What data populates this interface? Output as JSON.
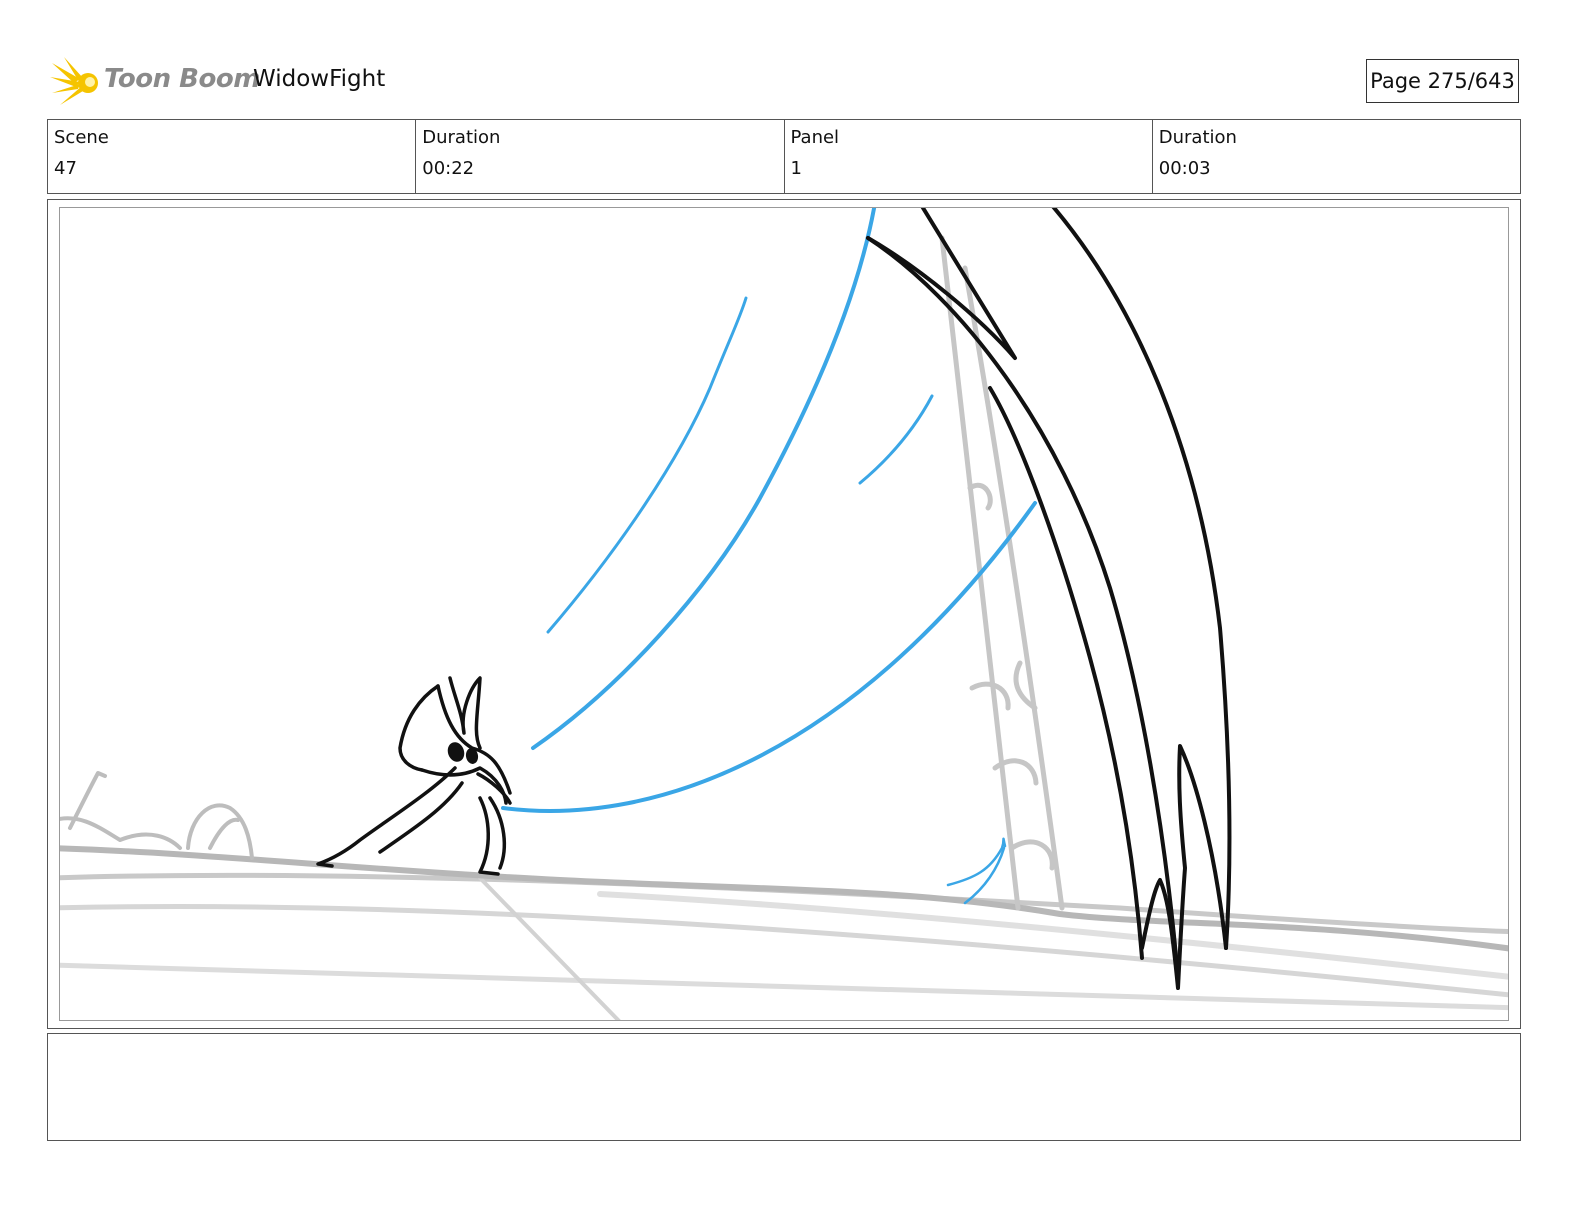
{
  "header": {
    "logo_text": "Toon Boom",
    "project_title": "WidowFight",
    "page_indicator": "Page 275/643"
  },
  "info": [
    {
      "label": "Scene",
      "value": "47"
    },
    {
      "label": "Duration",
      "value": "00:22"
    },
    {
      "label": "Panel",
      "value": "1"
    },
    {
      "label": "Duration",
      "value": "00:03"
    }
  ],
  "panel": {
    "description": "",
    "colors": {
      "ink": "#111111",
      "thread": "#3aa6e6",
      "background_lines": "#c4c4c4",
      "ground": "#b3b3b3"
    }
  },
  "notes": {
    "text": ""
  },
  "brand": {
    "logo_star_color": "#f5c400",
    "logo_text_color": "#8a8a8a"
  }
}
